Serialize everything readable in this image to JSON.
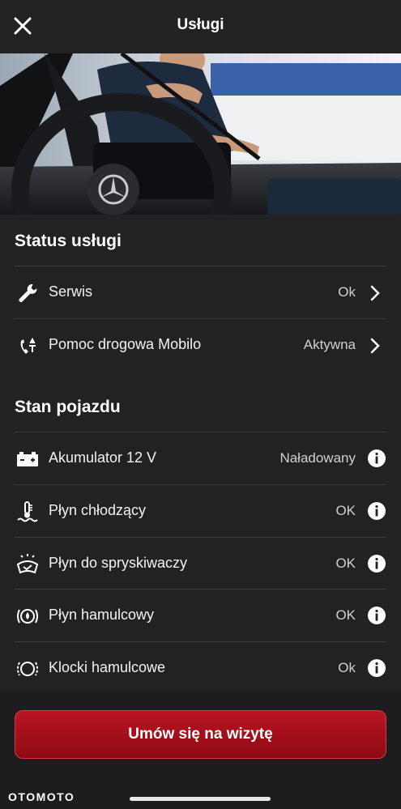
{
  "header": {
    "title": "Usługi",
    "close_icon": "close-icon"
  },
  "hero": {
    "image": "car-interior-photo",
    "logo": "mercedes-star-logo"
  },
  "status_section": {
    "title": "Status usługi",
    "items": [
      {
        "label": "Serwis",
        "value": "Ok",
        "icon": "wrench-icon"
      },
      {
        "label": "Pomoc drogowa Mobilo",
        "value": "Aktywna",
        "icon": "roadside-phone-icon"
      }
    ]
  },
  "vehicle_section": {
    "title": "Stan pojazdu",
    "items": [
      {
        "label": "Akumulator 12 V",
        "value": "Naładowany",
        "icon": "battery-icon"
      },
      {
        "label": "Płyn chłodzący",
        "value": "OK",
        "icon": "coolant-icon"
      },
      {
        "label": "Płyn do spryskiwaczy",
        "value": "OK",
        "icon": "washer-fluid-icon"
      },
      {
        "label": "Płyn hamulcowy",
        "value": "OK",
        "icon": "brake-fluid-icon"
      },
      {
        "label": "Klocki hamulcowe",
        "value": "Ok",
        "icon": "brake-pads-icon"
      }
    ]
  },
  "cta": {
    "label": "Umów się na wizytę"
  },
  "watermark": "OTOMOTO",
  "colors": {
    "background": "#222224",
    "accent": "#a80f1b",
    "divider": "#3c3c3e"
  }
}
